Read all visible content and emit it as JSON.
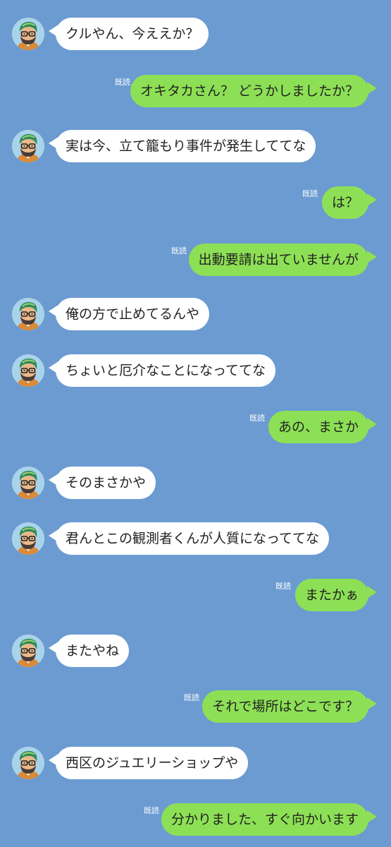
{
  "read_label": "既読",
  "messages": [
    {
      "side": "in",
      "text": "クルやん、今ええか？"
    },
    {
      "side": "out",
      "text": "オキタカさん？ どうかしましたか？"
    },
    {
      "side": "in",
      "text": "実は今、立て籠もり事件が発生しててな"
    },
    {
      "side": "out",
      "text": "は？"
    },
    {
      "side": "out",
      "text": "出動要請は出ていませんが"
    },
    {
      "side": "in",
      "text": "俺の方で止めてるんや"
    },
    {
      "side": "in",
      "text": "ちょいと厄介なことになっててな"
    },
    {
      "side": "out",
      "text": "あの、まさか"
    },
    {
      "side": "in",
      "text": "そのまさかや"
    },
    {
      "side": "in",
      "text": "君んとこの観測者くんが人質になっててな"
    },
    {
      "side": "out",
      "text": "またかぁ"
    },
    {
      "side": "in",
      "text": "またやね"
    },
    {
      "side": "out",
      "text": "それで場所はどこです？"
    },
    {
      "side": "in",
      "text": "西区のジュエリーショップや"
    },
    {
      "side": "out",
      "text": "分かりました、すぐ向かいます"
    }
  ],
  "colors": {
    "background": "#6b9bd1",
    "incoming_bubble": "#ffffff",
    "outgoing_bubble": "#8de055"
  },
  "icons": {
    "avatar": "bearded-man-with-glasses-avatar-icon"
  }
}
